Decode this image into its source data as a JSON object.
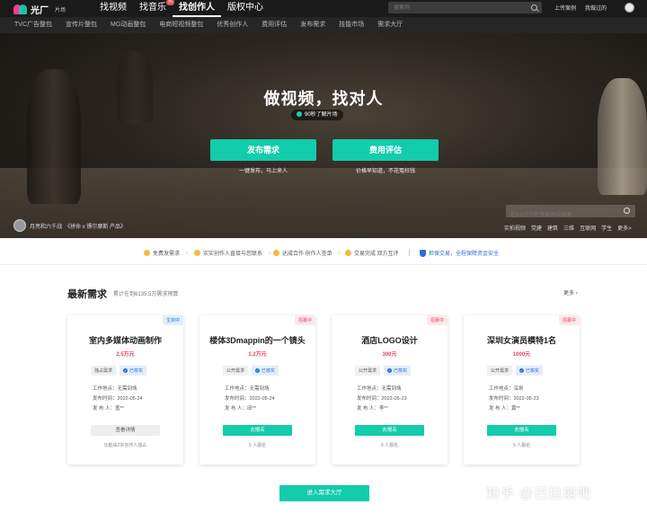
{
  "brand": {
    "name": "光厂",
    "sub": "片场",
    "colors": {
      "primary": "#12ccab",
      "hot": "#e84e4e",
      "blue": "#2b6fd6",
      "red": "#e0455f"
    }
  },
  "nav": {
    "items": [
      {
        "label": "找视频",
        "active": false,
        "hot": ""
      },
      {
        "label": "找音乐",
        "active": false,
        "hot": "热"
      },
      {
        "label": "找创作人",
        "active": true,
        "hot": ""
      },
      {
        "label": "版权中心",
        "active": false,
        "hot": ""
      }
    ],
    "search_placeholder": "搜索例",
    "links": [
      "上传案例",
      "我做过的"
    ]
  },
  "subnav": [
    "TVC广告整包",
    "宣传片整包",
    "MG动画整包",
    "电商短视频整包",
    "优秀创作人",
    "费用评估",
    "发布需求",
    "技能市场",
    "需求大厅"
  ],
  "hero": {
    "title": "做视频，找对人",
    "pill": "90秒了解片场",
    "btn_publish": "发布需求",
    "btn_estimate": "费用评估",
    "sub_publish": "一键发布，马上来人",
    "sub_estimate": "价格早知道，不花冤枉钱",
    "credit": "月亮和六千战　《拼命 x 镖尔摩斯 产品》",
    "case_search_placeholder": "在2.6万个优秀案例中搜索",
    "tags": [
      "实拍视频",
      "党建",
      "建筑",
      "三维",
      "互联网",
      "学生",
      "更多>"
    ]
  },
  "steps": [
    "免费发需求",
    "实实创作人直接与您联系",
    "达成合作 创作人签单",
    "交易完成 双方互评"
  ],
  "guarantee": "担保交易，全程保障资金安全",
  "section": {
    "title": "最新需求",
    "subtitle": "累计在到6135.5万需求预算",
    "more": "更多 ›",
    "hall_button": "进入需求大厅"
  },
  "cards": [
    {
      "badge": "生单中",
      "badge_color": "blue",
      "title": "室内多媒体动画制作",
      "price": "2.5万元",
      "tag1": "独占需求",
      "tag2": "已核实",
      "info": [
        "工作地点：无需到场",
        "发布时间：2022-05-24",
        "发 布 人：盖**"
      ],
      "button": "查看详情",
      "button_style": "gray",
      "foot": "功能由2实创作人独占"
    },
    {
      "badge": "招募中",
      "badge_color": "red",
      "title": "楼体3Dmappin的一个镜头",
      "price": "1.2万元",
      "tag1": "公开需求",
      "tag2": "已核实",
      "info": [
        "工作地点：无需到场",
        "发布时间：2022-05-24",
        "发 布 人：邱**"
      ],
      "button": "去报名",
      "button_style": "green",
      "foot": "9 人报名"
    },
    {
      "badge": "招募中",
      "badge_color": "red",
      "title": "酒店LOGO设计",
      "price": "300元",
      "tag1": "公开需求",
      "tag2": "已核实",
      "info": [
        "工作地点：无需到场",
        "发布时间：2022-05-23",
        "发 布 人：李**"
      ],
      "button": "去报名",
      "button_style": "green",
      "foot": "9 人报名"
    },
    {
      "badge": "招募中",
      "badge_color": "red",
      "title": "深圳女演员模特1名",
      "price": "1000元",
      "tag1": "公开需求",
      "tag2": "已核实",
      "info": [
        "工作地点：深圳",
        "发布时间：2022-05-23",
        "发 布 人：黄**"
      ],
      "button": "去报名",
      "button_style": "green",
      "foot": "9 人报名"
    }
  ],
  "watermark": "知乎 @巴拉崩吧"
}
